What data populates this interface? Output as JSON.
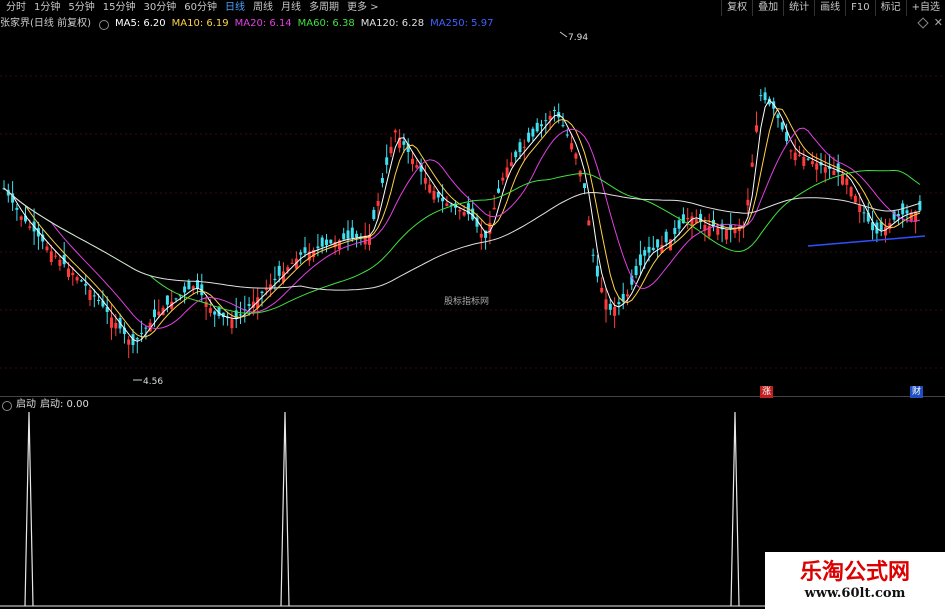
{
  "toolbar": {
    "periods": [
      "分时",
      "1分钟",
      "5分钟",
      "15分钟",
      "30分钟",
      "60分钟",
      "日线",
      "周线",
      "月线",
      "多周期",
      "更多 >"
    ],
    "active_period": "日线",
    "right_buttons": [
      "复权",
      "叠加",
      "统计",
      "画线",
      "F10",
      "标记",
      "+自选"
    ]
  },
  "info": {
    "title": "张家界(日线 前复权)",
    "ma": [
      {
        "label": "MA5: 6.20",
        "color": "#ffffff"
      },
      {
        "label": "MA10: 6.19",
        "color": "#ffd24a"
      },
      {
        "label": "MA20: 6.14",
        "color": "#e040e0"
      },
      {
        "label": "MA60: 6.38",
        "color": "#40e040"
      },
      {
        "label": "MA120: 6.28",
        "color": "#e0e0e0"
      },
      {
        "label": "MA250: 5.97",
        "color": "#4060ff"
      }
    ]
  },
  "main_chart": {
    "high_label": "7.94",
    "low_label": "4.56",
    "center_watermark": "股标指标网",
    "badge_zhang": "涨",
    "badge_cai": "财"
  },
  "sub_chart": {
    "title": "启动",
    "value_label": "启动: 0.00",
    "signals": [
      29,
      285,
      735
    ]
  },
  "watermark": {
    "line1": "乐淘公式网",
    "line2": "www.60lt.com"
  },
  "colors": {
    "up": "#ff3a3a",
    "down": "#40e0f0",
    "ma5": "#ffffff",
    "ma10": "#ffd24a",
    "ma20": "#e040e0",
    "ma60": "#40e040",
    "ma120": "#e0e0e0",
    "trend": "#3050ff"
  }
}
